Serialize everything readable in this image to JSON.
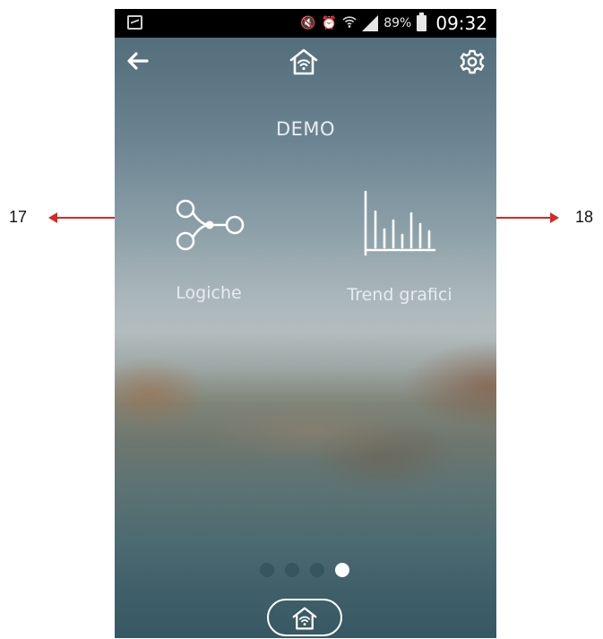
{
  "status_bar": {
    "battery_percent": "89%",
    "time": "09:32"
  },
  "header": {
    "back_icon": "back-arrow-icon",
    "home_icon": "wifi-home-icon",
    "settings_icon": "gear-icon"
  },
  "plant": {
    "name": "DEMO"
  },
  "tiles": [
    {
      "label": "Logiche",
      "icon": "logic-nodes-icon"
    },
    {
      "label": "Trend grafici",
      "icon": "bar-chart-icon"
    }
  ],
  "pager": {
    "pages": 4,
    "active_index": 3
  },
  "callouts": {
    "left": "17",
    "right": "18"
  },
  "colors": {
    "annotation_arrow": "#d42a2a",
    "dot_inactive": "#35555f",
    "dot_active": "#ffffff"
  }
}
